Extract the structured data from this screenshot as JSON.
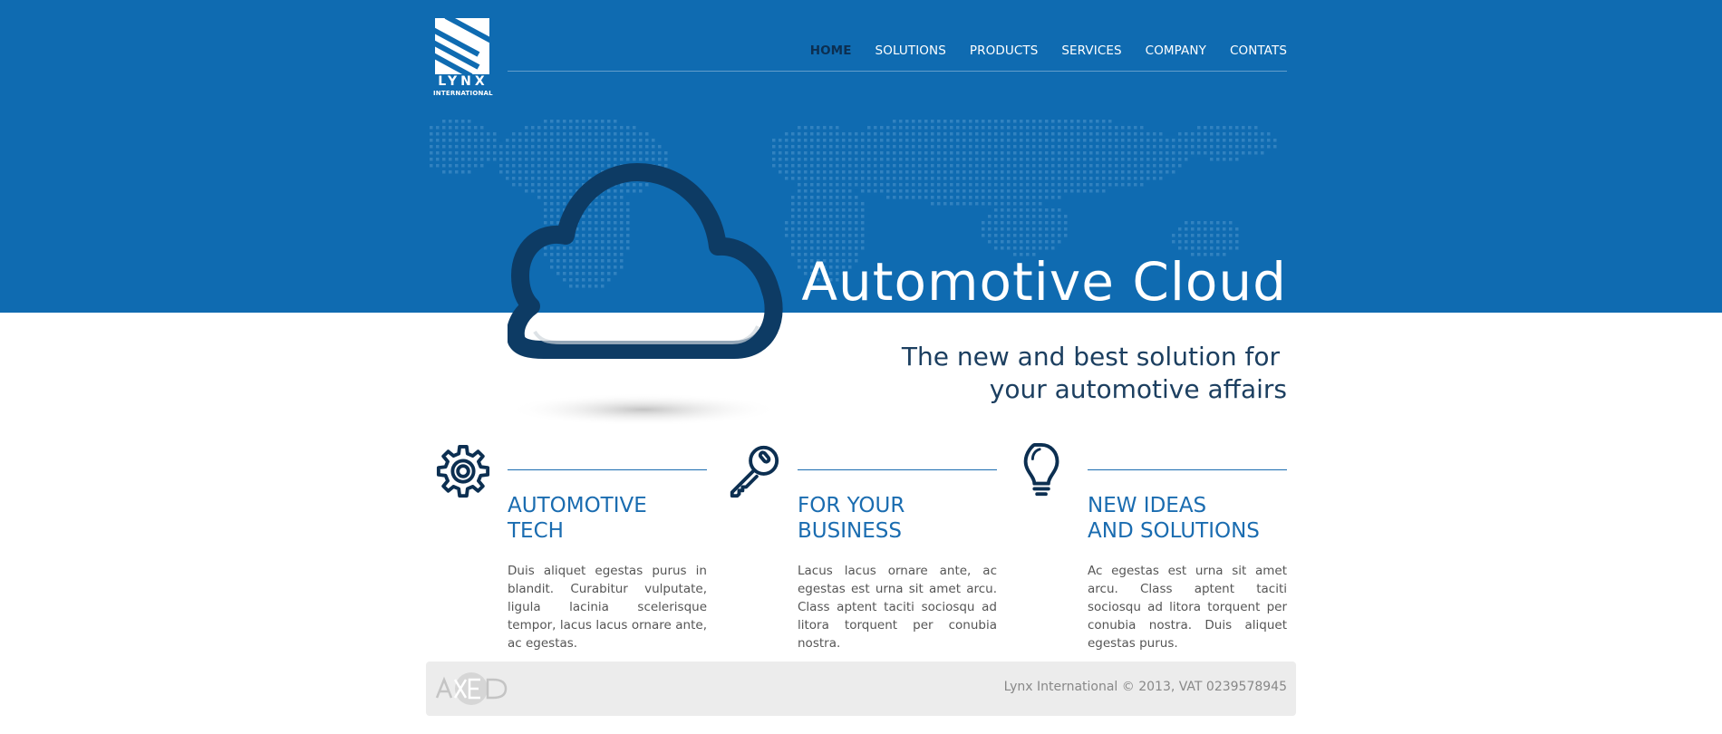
{
  "brand": {
    "logo_name": "LYNX",
    "logo_sub": "INTERNATIONAL"
  },
  "nav": {
    "items": [
      "HOME",
      "SOLUTIONS",
      "PRODUCTS",
      "SERVICES",
      "COMPANY",
      "CONTATS"
    ],
    "active": "HOME"
  },
  "hero": {
    "title": "Automotive Cloud",
    "subtitle_line1": "The new and best solution for",
    "subtitle_line2": "your automotive affairs",
    "icon": "cloud-icon"
  },
  "features": [
    {
      "icon": "gear-icon",
      "heading_line1": "AUTOMOTIVE",
      "heading_line2": "TECH",
      "text": "Duis aliquet egestas purus in blandit. Curabitur vulputate, ligula lacinia scelerisque tempor, lacus lacus ornare ante, ac egestas."
    },
    {
      "icon": "key-icon",
      "heading_line1": "FOR YOUR",
      "heading_line2": "BUSINESS",
      "text": "Lacus lacus ornare ante, ac egestas est urna sit amet arcu. Class aptent taciti sociosqu ad litora torquent per conubia nostra."
    },
    {
      "icon": "lightbulb-icon",
      "heading_line1": "NEW IDEAS",
      "heading_line2": "AND SOLUTIONS",
      "text": "Ac egestas est urna sit amet arcu. Class aptent taciti sociosqu ad litora torquent per conubia nostra. Duis aliquet egestas purus."
    }
  ],
  "footer": {
    "partner_logo": "axed-logo",
    "copyright": "Lynx International © 2013, VAT 0239578945"
  },
  "colors": {
    "brand_blue": "#0f6bb1",
    "dark_navy": "#0c2f51",
    "accent_blue": "#1a6cb0",
    "footer_bg": "#ececec"
  }
}
